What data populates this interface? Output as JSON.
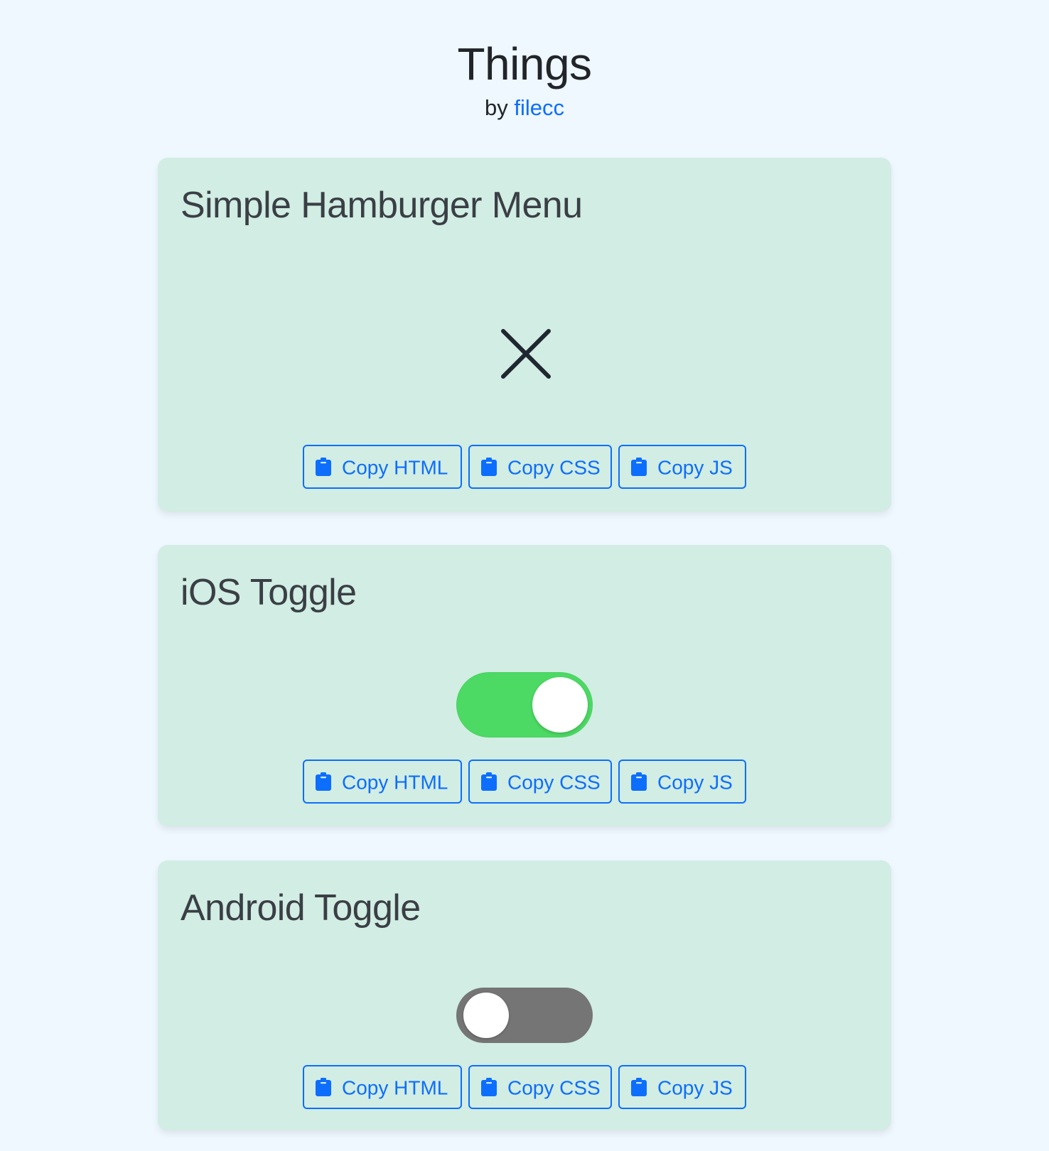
{
  "header": {
    "title": "Things",
    "by_prefix": "by",
    "author": "filecc"
  },
  "colors": {
    "page_background": "#eff7ff",
    "card_background": "#d2ede3",
    "accent": "#0d6efd",
    "ios_on": "#4cd964",
    "android_off": "#757575"
  },
  "buttons": {
    "copy_html": "Copy HTML",
    "copy_css": "Copy CSS",
    "copy_js": "Copy JS",
    "icon": "clipboard-icon"
  },
  "cards": [
    {
      "title": "Simple Hamburger Menu",
      "demo": "close-icon",
      "state": "open"
    },
    {
      "title": "iOS Toggle",
      "demo": "ios-toggle",
      "checked": true
    },
    {
      "title": "Android Toggle",
      "demo": "android-toggle",
      "checked": false
    }
  ]
}
